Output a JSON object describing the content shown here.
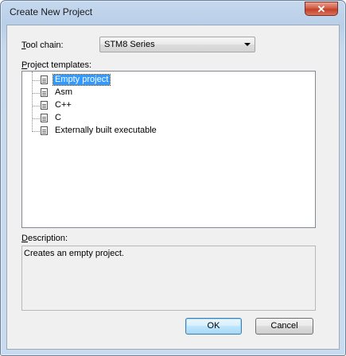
{
  "window": {
    "title": "Create New Project",
    "close_glyph": "✕"
  },
  "toolchain": {
    "label_prefix": "",
    "label_mnemonic": "T",
    "label_rest": "ool chain:",
    "selected": "STM8 Series"
  },
  "templates": {
    "label_mnemonic": "P",
    "label_rest": "roject templates:",
    "items": [
      {
        "label": "Empty project",
        "selected": true
      },
      {
        "label": "Asm",
        "selected": false
      },
      {
        "label": "C++",
        "selected": false
      },
      {
        "label": "C",
        "selected": false
      },
      {
        "label": "Externally built executable",
        "selected": false
      }
    ]
  },
  "description": {
    "label_mnemonic": "D",
    "label_rest": "escription:",
    "text": "Creates an empty project."
  },
  "buttons": {
    "ok": "OK",
    "cancel": "Cancel"
  },
  "colors": {
    "selection": "#3399ff",
    "client_bg": "#f0f0f0",
    "close_red": "#c3402a"
  },
  "icons": {
    "close": "close-icon",
    "template": "document-icon",
    "dropdown": "chevron-down-icon"
  }
}
